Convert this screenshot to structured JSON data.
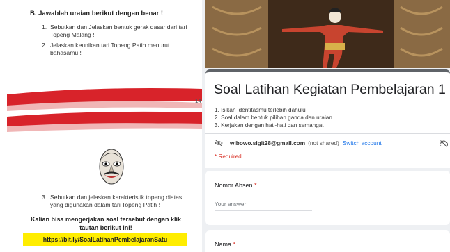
{
  "document": {
    "section_title": "B. Jawablah uraian berikut dengan benar !",
    "questions": [
      {
        "num": "1.",
        "text": "Sebutkan dan Jelaskan bentuk gerak dasar dari tari Topeng Malang !"
      },
      {
        "num": "2.",
        "text": "Jelaskan keunikan tari Topeng Patih menurut bahasamu !"
      }
    ],
    "page_number": "14",
    "question3": {
      "num": "3.",
      "text": "Sebutkan dan jelaskan karakteristik topeng diatas yang digunakan dalam tari Topeng Patih !"
    },
    "link_instruction": "Kalian bisa mengerjakan soal tersebut dengan klik tautan berikut ini!",
    "link_url": "https://bit.ly/SoalLatihanPembelajaranSatu"
  },
  "form": {
    "title": "Soal Latihan Kegiatan Pembelajaran 1",
    "description": [
      "1. Isikan identitasmu terlebih dahulu",
      "2. Soal dalam bentuk pilihan ganda dan uraian",
      "3. Kerjakan dengan hati-hati dan semangat"
    ],
    "account_email": "wibowo.sigit28@gmail.com",
    "not_shared": "(not shared)",
    "switch_account": "Switch account",
    "required_note": "* Required",
    "questions": [
      {
        "label": "Nomor Absen",
        "star": "*",
        "answer_placeholder": "Your answer"
      },
      {
        "label": "Nama",
        "star": "*"
      }
    ]
  },
  "colors": {
    "stripe_red": "#d8232a",
    "link_highlight": "#ffed00",
    "accent_blue": "#1a73e8",
    "required_red": "#d93025"
  },
  "icons": [
    "eye-off-icon",
    "cloud-off-icon"
  ]
}
